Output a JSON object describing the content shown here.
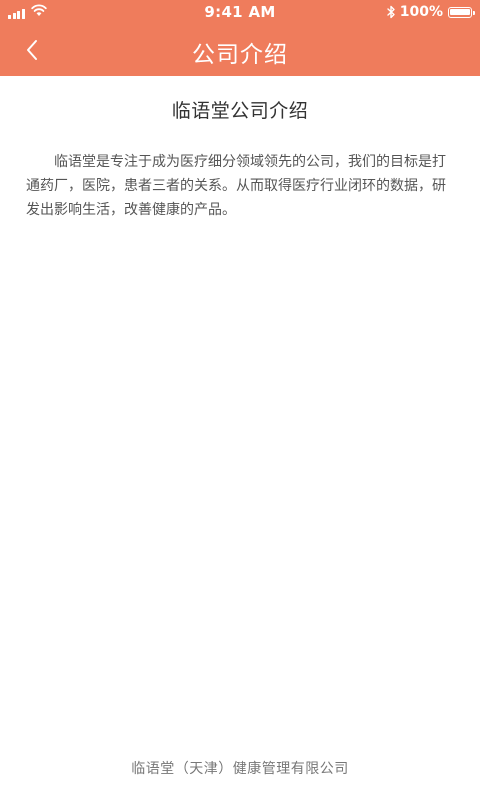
{
  "status_bar": {
    "time": "9:41 AM",
    "battery_percent": "100%",
    "battery_level": 1.0
  },
  "nav": {
    "title": "公司介绍",
    "back_icon": "chevron-left-icon"
  },
  "article": {
    "title": "临语堂公司介绍",
    "body": "临语堂是专注于成为医疗细分领域领先的公司，我们的目标是打通药厂，医院，患者三者的关系。从而取得医疗行业闭环的数据，研发出影响生活，改善健康的产品。"
  },
  "footer": {
    "company": "临语堂（天津）健康管理有限公司"
  },
  "colors": {
    "header": "#ef7c5c",
    "background": "#ffffff",
    "text": "#333333"
  }
}
